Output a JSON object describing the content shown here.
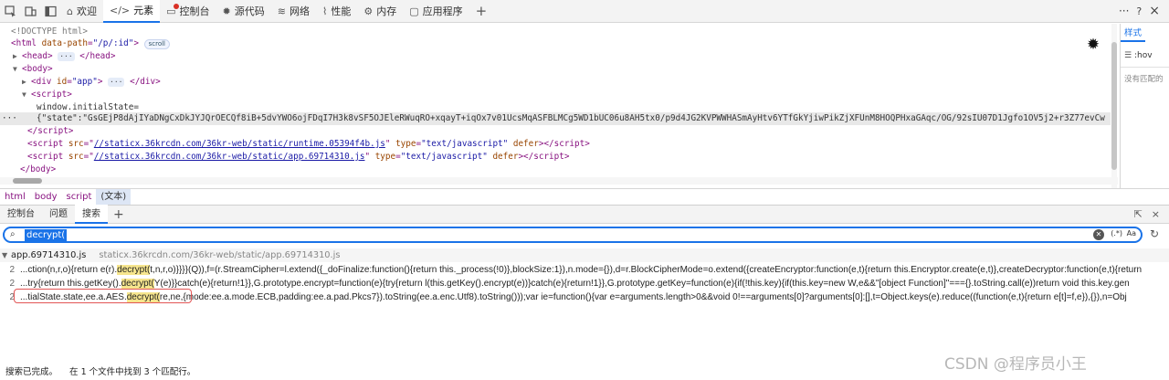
{
  "tabbar": {
    "tabs": [
      {
        "label": "欢迎",
        "icon": "home-icon"
      },
      {
        "label": "元素",
        "icon": "code-icon",
        "active": true
      },
      {
        "label": "控制台",
        "icon": "console-icon"
      },
      {
        "label": "源代码",
        "icon": "bug-icon"
      },
      {
        "label": "网络",
        "icon": "wifi-icon"
      },
      {
        "label": "性能",
        "icon": "performance-icon"
      },
      {
        "label": "内存",
        "icon": "memory-icon"
      },
      {
        "label": "应用程序",
        "icon": "application-icon"
      }
    ],
    "add": "+",
    "more": "···",
    "help": "?",
    "close": "×"
  },
  "elements": {
    "doctype": "<!DOCTYPE html>",
    "html_tag": "html",
    "html_attr": "data-path",
    "html_attr_val": "\"/p/:id\"",
    "scroll_badge": "scroll",
    "head": "head",
    "body": "body",
    "div_attr": "id",
    "div_val": "\"app\"",
    "script": "script",
    "window_text": "window.initialState=",
    "state_line": "{\"state\":\"GsGEjP8dAjIYaDNgCxDkJYJQrOECQf8iB+5dvYWO6ojFDqI7H3k8vSF5OJEleRWuqRO+xqayT+iqOx7v01UcsMqASFBLMCg5WD1bUC06u8AH5tx0/p9d4JG2KVPWWHASmAyHtv6YTfGkYjiwPikZjXFUnM8HOQPHxaGAqc/OG/92sIU07D1Jgfo1OV5j2+r3Z77evCw",
    "script1_src_attr": "src",
    "script1_src": "//staticx.36krcdn.com/36kr-web/static/runtime.05394f4b.js",
    "script2_src": "//staticx.36krcdn.com/36kr-web/static/app.69714310.js",
    "type_attr": "type",
    "type_val": "\"text/javascript\"",
    "defer": "defer",
    "ellipsis": "···"
  },
  "styles_pane": {
    "tab": "样式",
    "filter": ":hov",
    "empty": "没有匹配的"
  },
  "breadcrumb": [
    "html",
    "body",
    "script",
    "(文本)"
  ],
  "drawer": {
    "tabs": [
      {
        "label": "控制台"
      },
      {
        "label": "问题"
      },
      {
        "label": "搜索",
        "active": true
      }
    ],
    "add": "+"
  },
  "search": {
    "query": "decrypt(",
    "regex_label": "(.*)",
    "case_label": "Aa"
  },
  "results": {
    "file": "app.69714310.js",
    "path": "staticx.36krcdn.com/36kr-web/static/app.69714310.js",
    "lines": [
      {
        "no": "2",
        "pre": "...ction(n,r,o){return e(r).",
        "match": "decrypt(",
        "post": "t,n,r,o)}}}}(Q)),f=(r.StreamCipher=l.extend({_doFinalize:function(){return this._process(!0)},blockSize:1}),n.mode={}),d=r.BlockCipherMode=o.extend({createEncryptor:function(e,t){return this.Encryptor.create(e,t)},createDecryptor:function(e,t){return"
      },
      {
        "no": "2",
        "pre": "...try{return this.getKey().",
        "match": "decrypt(",
        "post": "Y(e)}}catch(e){return!1}},G.prototype.encrypt=function(e){try{return l(this.getKey().encrypt(e))}catch(e){return!1}},G.prototype.getKey=function(e){if(!this.key){if(this.key=new W,e&&\"[object Function]\"==={}.toString.call(e))return void this.key.gen"
      },
      {
        "no": "2",
        "pre": "...tialState.state,ee.a.AES.",
        "match": "decrypt(",
        "post": "re,ne,{mode:ee.a.mode.ECB,padding:ee.a.pad.Pkcs7}).toString(ee.a.enc.Utf8).toString()));var ie=function(){var e=arguments.length>0&&void 0!==arguments[0]?arguments[0]:[],t=Object.keys(e).reduce((function(e,t){return e[t]=f,e}),{}),n=Obj"
      }
    ]
  },
  "status": {
    "done": "搜索已完成。",
    "summary": "在 1 个文件中找到 3 个匹配行。"
  },
  "watermark": "CSDN @程序员小王"
}
